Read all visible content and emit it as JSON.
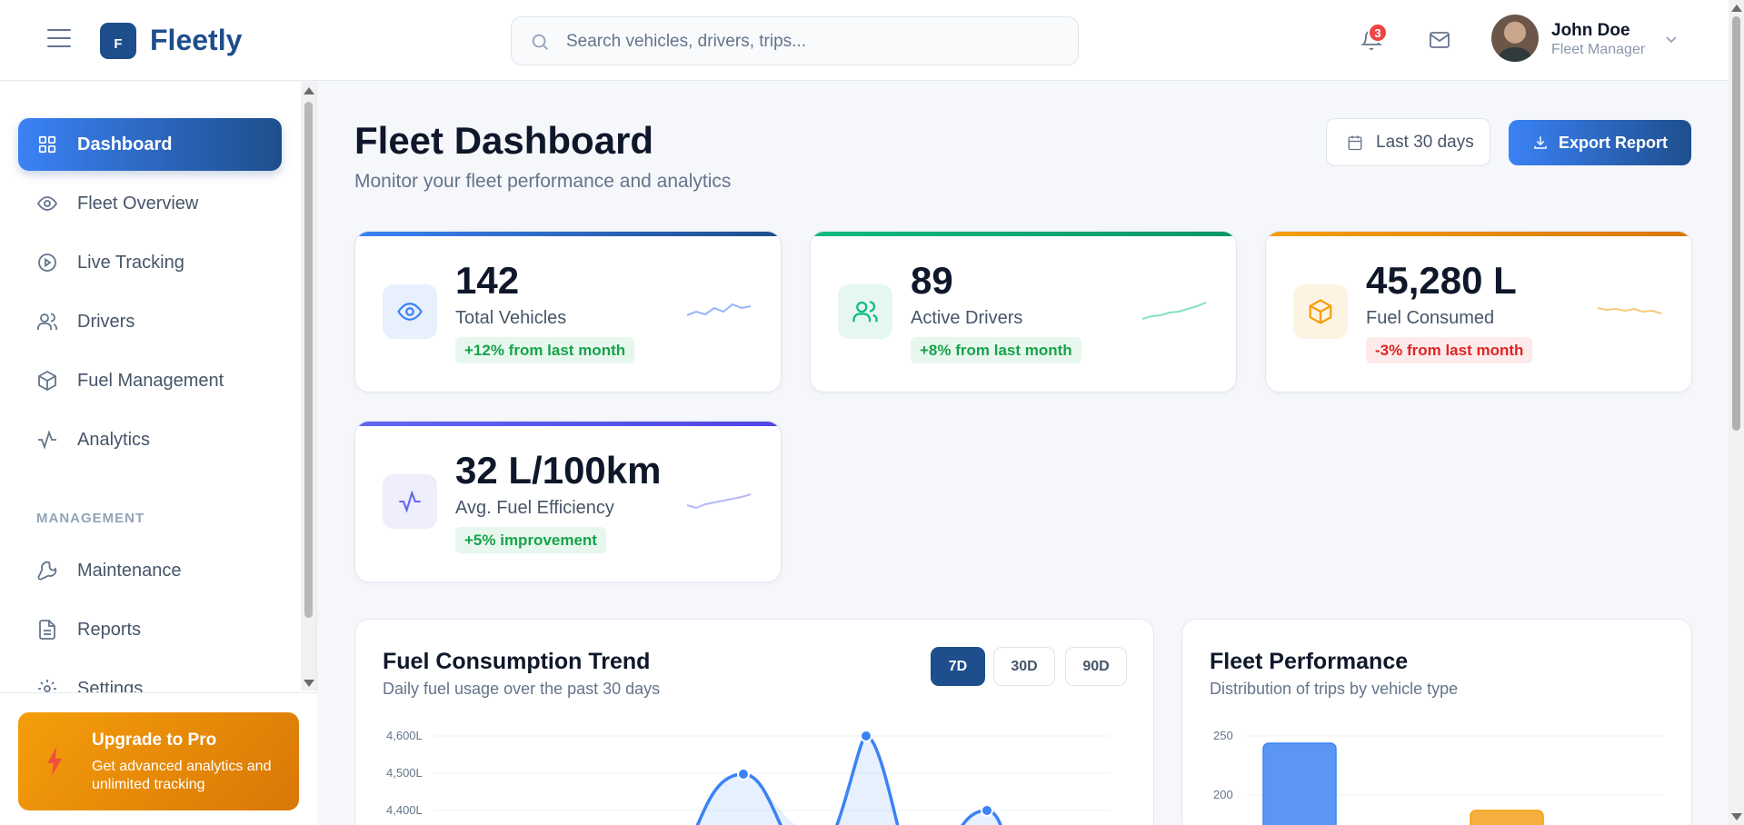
{
  "app": {
    "logo_letter": "F",
    "name": "Fleetly"
  },
  "search": {
    "placeholder": "Search vehicles, drivers, trips..."
  },
  "notifications": {
    "count": "3"
  },
  "user": {
    "name": "John Doe",
    "role": "Fleet Manager"
  },
  "sidebar": {
    "items": [
      {
        "label": "Dashboard",
        "icon": "grid-icon",
        "active": true
      },
      {
        "label": "Fleet Overview",
        "icon": "eye-icon"
      },
      {
        "label": "Live Tracking",
        "icon": "play-circle-icon"
      },
      {
        "label": "Drivers",
        "icon": "users-icon"
      },
      {
        "label": "Fuel Management",
        "icon": "box-icon"
      },
      {
        "label": "Analytics",
        "icon": "activity-icon"
      }
    ],
    "section_label": "MANAGEMENT",
    "management_items": [
      {
        "label": "Maintenance",
        "icon": "wrench-icon"
      },
      {
        "label": "Reports",
        "icon": "file-icon"
      },
      {
        "label": "Settings",
        "icon": "gear-icon"
      }
    ],
    "upgrade": {
      "title": "Upgrade to Pro",
      "subtitle": "Get advanced analytics and unlimited tracking"
    }
  },
  "header": {
    "title": "Fleet Dashboard",
    "subtitle": "Monitor your fleet performance and analytics",
    "date_range": "Last 30 days",
    "export_label": "Export Report"
  },
  "stats": [
    {
      "value": "142",
      "label": "Total Vehicles",
      "change": "+12% from last month",
      "trend": "positive",
      "color": "#3b82f6",
      "icon": "eye-icon"
    },
    {
      "value": "89",
      "label": "Active Drivers",
      "change": "+8% from last month",
      "trend": "positive",
      "color": "#10b981",
      "icon": "users-icon"
    },
    {
      "value": "45,280 L",
      "label": "Fuel Consumed",
      "change": "-3% from last month",
      "trend": "negative",
      "color": "#f59e0b",
      "icon": "box-icon"
    },
    {
      "value": "32 L/100km",
      "label": "Avg. Fuel Efficiency",
      "change": "+5% improvement",
      "trend": "positive",
      "color": "#6366f1",
      "icon": "activity-icon"
    }
  ],
  "fuel_panel": {
    "title": "Fuel Consumption Trend",
    "subtitle": "Daily fuel usage over the past 30 days",
    "ranges": [
      "7D",
      "30D",
      "90D"
    ],
    "selected_range": "7D",
    "y_ticks": [
      "4,600L",
      "4,500L",
      "4,400L"
    ]
  },
  "performance_panel": {
    "title": "Fleet Performance",
    "subtitle": "Distribution of trips by vehicle type",
    "y_ticks": [
      "250",
      "200"
    ]
  },
  "colors": {
    "primary": "#1e4e8c",
    "accent": "#3b82f6",
    "success": "#16a34a",
    "danger": "#dc2626",
    "warning": "#f59e0b"
  }
}
